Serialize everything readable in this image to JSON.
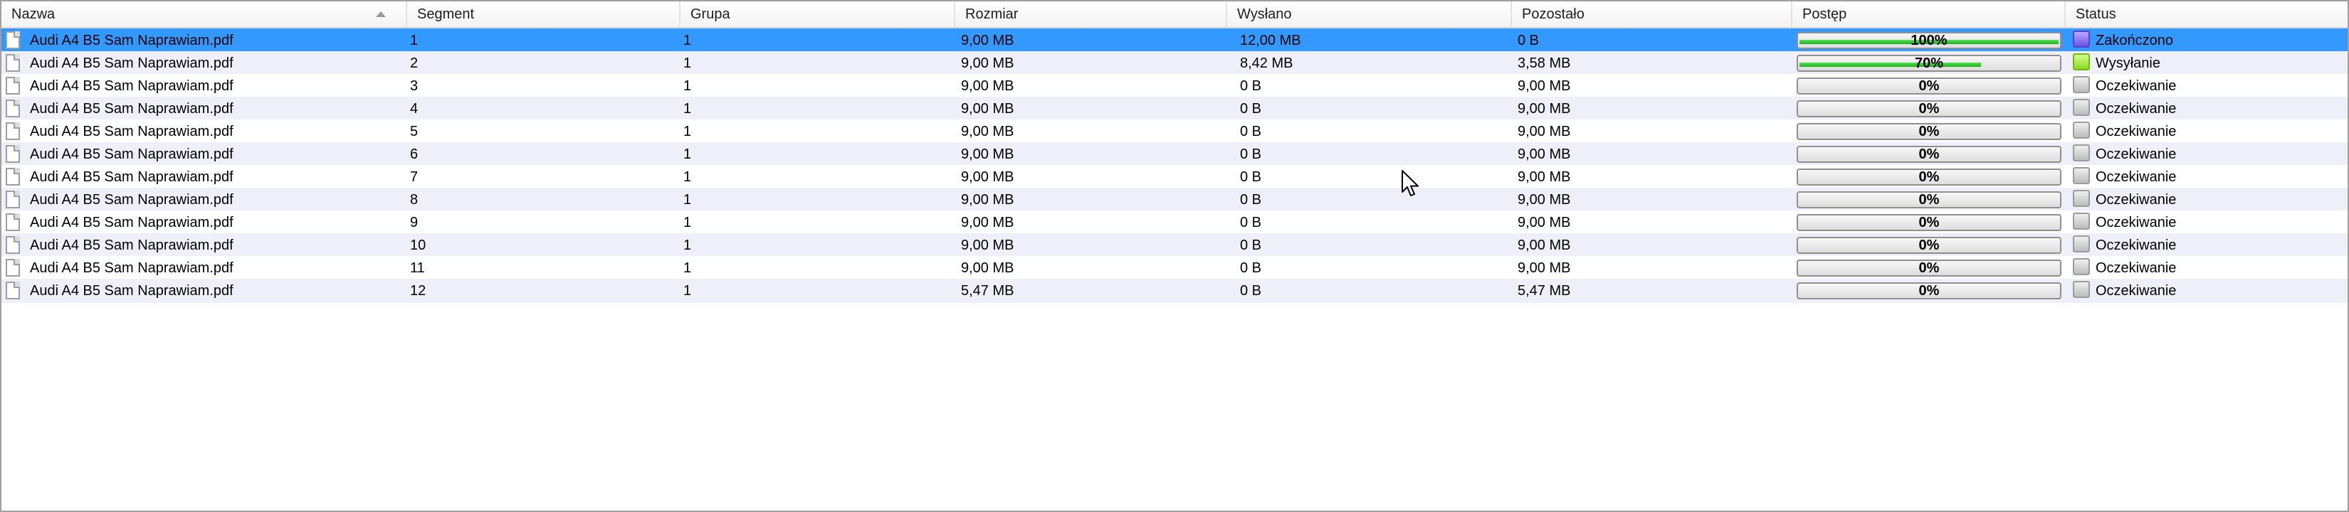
{
  "columns": [
    {
      "key": "name",
      "label": "Nazwa",
      "sorted": true
    },
    {
      "key": "segment",
      "label": "Segment"
    },
    {
      "key": "group",
      "label": "Grupa"
    },
    {
      "key": "size",
      "label": "Rozmiar"
    },
    {
      "key": "sent",
      "label": "Wysłano"
    },
    {
      "key": "remaining",
      "label": "Pozostało"
    },
    {
      "key": "progress",
      "label": "Postęp"
    },
    {
      "key": "status",
      "label": "Status"
    }
  ],
  "rows": [
    {
      "name": "Audi A4 B5 Sam Naprawiam.pdf",
      "segment": "1",
      "group": "1",
      "size": "9,00 MB",
      "sent": "12,00 MB",
      "remaining": "0 B",
      "progress": 100,
      "progress_label": "100%",
      "status": "Zakończono",
      "status_kind": "done",
      "selected": true
    },
    {
      "name": "Audi A4 B5 Sam Naprawiam.pdf",
      "segment": "2",
      "group": "1",
      "size": "9,00 MB",
      "sent": "8,42 MB",
      "remaining": "3,58 MB",
      "progress": 70,
      "progress_label": "70%",
      "status": "Wysyłanie",
      "status_kind": "sending"
    },
    {
      "name": "Audi A4 B5 Sam Naprawiam.pdf",
      "segment": "3",
      "group": "1",
      "size": "9,00 MB",
      "sent": "0 B",
      "remaining": "9,00 MB",
      "progress": 0,
      "progress_label": "0%",
      "status": "Oczekiwanie",
      "status_kind": "waiting"
    },
    {
      "name": "Audi A4 B5 Sam Naprawiam.pdf",
      "segment": "4",
      "group": "1",
      "size": "9,00 MB",
      "sent": "0 B",
      "remaining": "9,00 MB",
      "progress": 0,
      "progress_label": "0%",
      "status": "Oczekiwanie",
      "status_kind": "waiting"
    },
    {
      "name": "Audi A4 B5 Sam Naprawiam.pdf",
      "segment": "5",
      "group": "1",
      "size": "9,00 MB",
      "sent": "0 B",
      "remaining": "9,00 MB",
      "progress": 0,
      "progress_label": "0%",
      "status": "Oczekiwanie",
      "status_kind": "waiting"
    },
    {
      "name": "Audi A4 B5 Sam Naprawiam.pdf",
      "segment": "6",
      "group": "1",
      "size": "9,00 MB",
      "sent": "0 B",
      "remaining": "9,00 MB",
      "progress": 0,
      "progress_label": "0%",
      "status": "Oczekiwanie",
      "status_kind": "waiting"
    },
    {
      "name": "Audi A4 B5 Sam Naprawiam.pdf",
      "segment": "7",
      "group": "1",
      "size": "9,00 MB",
      "sent": "0 B",
      "remaining": "9,00 MB",
      "progress": 0,
      "progress_label": "0%",
      "status": "Oczekiwanie",
      "status_kind": "waiting"
    },
    {
      "name": "Audi A4 B5 Sam Naprawiam.pdf",
      "segment": "8",
      "group": "1",
      "size": "9,00 MB",
      "sent": "0 B",
      "remaining": "9,00 MB",
      "progress": 0,
      "progress_label": "0%",
      "status": "Oczekiwanie",
      "status_kind": "waiting"
    },
    {
      "name": "Audi A4 B5 Sam Naprawiam.pdf",
      "segment": "9",
      "group": "1",
      "size": "9,00 MB",
      "sent": "0 B",
      "remaining": "9,00 MB",
      "progress": 0,
      "progress_label": "0%",
      "status": "Oczekiwanie",
      "status_kind": "waiting"
    },
    {
      "name": "Audi A4 B5 Sam Naprawiam.pdf",
      "segment": "10",
      "group": "1",
      "size": "9,00 MB",
      "sent": "0 B",
      "remaining": "9,00 MB",
      "progress": 0,
      "progress_label": "0%",
      "status": "Oczekiwanie",
      "status_kind": "waiting"
    },
    {
      "name": "Audi A4 B5 Sam Naprawiam.pdf",
      "segment": "11",
      "group": "1",
      "size": "9,00 MB",
      "sent": "0 B",
      "remaining": "9,00 MB",
      "progress": 0,
      "progress_label": "0%",
      "status": "Oczekiwanie",
      "status_kind": "waiting"
    },
    {
      "name": "Audi A4 B5 Sam Naprawiam.pdf",
      "segment": "12",
      "group": "1",
      "size": "5,47 MB",
      "sent": "0 B",
      "remaining": "5,47 MB",
      "progress": 0,
      "progress_label": "0%",
      "status": "Oczekiwanie",
      "status_kind": "waiting"
    }
  ],
  "colors": {
    "selected_row": "#3399ff",
    "alt_row": "#efeff9",
    "progress_fill": "#22c022",
    "status_done": "#6c54e6",
    "status_sending": "#8bd81e",
    "status_waiting": "#bdbdbd"
  },
  "icons": {
    "file": "document-icon",
    "sort": "sort-ascending-icon",
    "cursor": "mouse-pointer-icon"
  }
}
